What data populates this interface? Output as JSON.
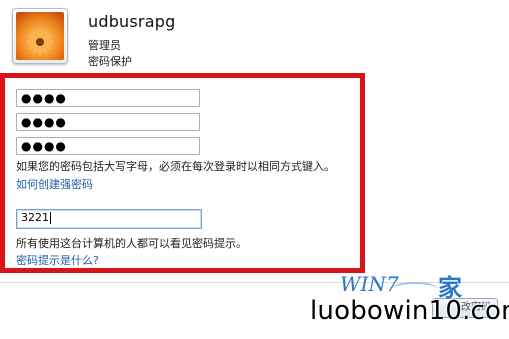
{
  "account": {
    "username": "udbusrapg",
    "role": "管理员",
    "password_status": "密码保护",
    "avatar_icon": "orange-flower-avatar"
  },
  "form": {
    "current_password_mask": "●●●●",
    "new_password_mask": "●●●●",
    "confirm_password_mask": "●●●●",
    "case_note": "如果您的密码包括大写字母，必须在每次登录时以相同方式键入。",
    "strong_password_link": "如何创建强密码",
    "hint_value": "3221",
    "hint_note": "所有使用这台计算机的人都可以看见密码提示。",
    "hint_help_link": "密码提示是什么?"
  },
  "footer": {
    "button_fragment": "改密码"
  },
  "watermark": {
    "logo_text": "WIN7",
    "logo_char": "家",
    "site": "luobowin10.com"
  },
  "colors": {
    "highlight_frame": "#d8141a",
    "link": "#1e5fa8",
    "logo": "#2d75c6"
  }
}
